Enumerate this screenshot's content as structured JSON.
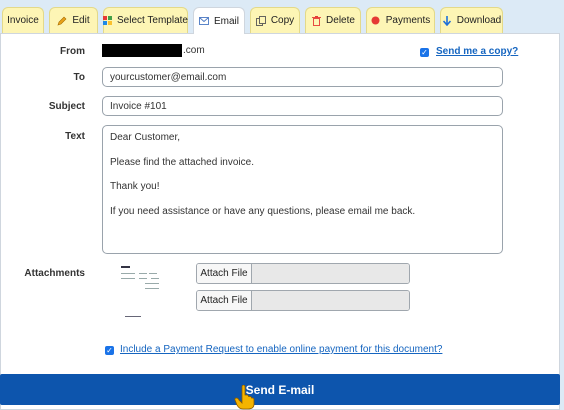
{
  "tabs": [
    {
      "label": "Invoice",
      "icon": "none"
    },
    {
      "label": "Edit",
      "icon": "pencil-icon"
    },
    {
      "label": "Select Template",
      "icon": "grid-icon"
    },
    {
      "label": "Email",
      "icon": "envelope-icon"
    },
    {
      "label": "Copy",
      "icon": "copy-icon"
    },
    {
      "label": "Delete",
      "icon": "trash-icon"
    },
    {
      "label": "Payments",
      "icon": "dot-icon"
    },
    {
      "label": "Download",
      "icon": "arrow-down-icon"
    }
  ],
  "active_tab": "Email",
  "form": {
    "from_label": "From",
    "from_domain": ".com",
    "send_copy_label": "Send me a copy?",
    "send_copy_checked": true,
    "to_label": "To",
    "to_value": "yourcustomer@email.com",
    "subject_label": "Subject",
    "subject_value": "Invoice #101",
    "text_label": "Text",
    "text_value": "Dear Customer,\n\nPlease find the attached invoice.\n\nThank you!\n\nIf you need assistance or have any questions, please email me back.",
    "attachments_label": "Attachments",
    "attach_button": "Attach File",
    "payment_request_label": "Include a Payment Request to enable online payment for this document?",
    "payment_request_checked": true
  },
  "send_button": "Send E-mail",
  "colors": {
    "tab_bg": "#fdf5b5",
    "send_bg": "#0d55ad",
    "link": "#1565c0",
    "page_bg": "#dceaf6"
  }
}
